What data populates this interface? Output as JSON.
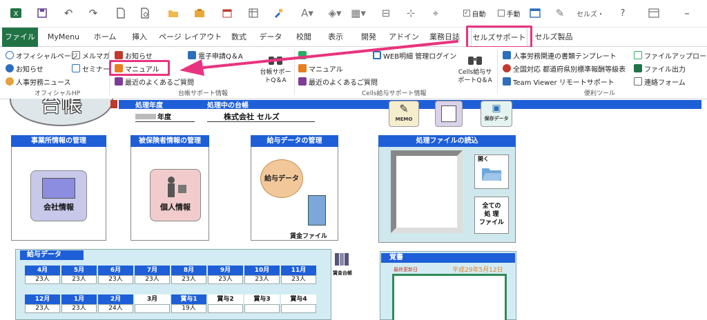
{
  "toolbar": {
    "auto_label": "自動",
    "manual_label": "手動",
    "cells_menu": "セルズ・",
    "help": "?"
  },
  "tabs": [
    "ファイル",
    "MyMenu",
    "ホーム",
    "挿入",
    "ページ レイアウト",
    "数式",
    "データ",
    "校閲",
    "表示",
    "開発",
    "アドイン",
    "業務日誌",
    "セルズサポート",
    "セルズ製品"
  ],
  "ribbon": {
    "official": {
      "items": [
        "オフィシャルページ",
        "メルマガ",
        "お知らせ",
        "セミナー",
        "人事労務ニュース"
      ],
      "group": "オフィシャルHP"
    },
    "daicho": {
      "items": [
        "お知らせ",
        "マニュアル",
        "最近のよくあるご質問",
        "電子申請Q＆A"
      ],
      "big_button": [
        "台帳サポー",
        "トQ＆A"
      ],
      "group": "台帳サポート情報"
    },
    "cells_kyuyo": {
      "items": [
        "マニュアル",
        "最近のよくあるご質問",
        "WEB明細 管理ログイン"
      ],
      "big_button": [
        "Cells給与サ",
        "ポートQ＆A"
      ],
      "group": "Cells給与サポート情報"
    },
    "benri": {
      "items": [
        "人事労務関連の書類テンプレート",
        "全国対応 都道府県別標準報酬等級表",
        "Team Viewer リモートサポート",
        "ファイルアップロード",
        "ファイル出力",
        "連絡フォーム"
      ],
      "group": "便利ツール"
    }
  },
  "sheet": {
    "logo_text": "台帳",
    "header_left": "処理年度",
    "header_right": "処理中の台帳",
    "year_suffix": "年度",
    "company": "株式会社 セルズ",
    "memo": "MEMO",
    "save_data": "保存データ",
    "panels": {
      "office": {
        "title": "事業所情報の管理",
        "button": "会社情報"
      },
      "insured": {
        "title": "被保険者情報の管理",
        "button": "個人情報"
      },
      "salary": {
        "title": "給与データの管理",
        "button": "給与データ",
        "file": "賃金ファイル"
      },
      "files": {
        "title": "処理ファイルの読込",
        "open": "開く",
        "all": [
          "全ての",
          "処 理",
          "ファイル"
        ]
      }
    },
    "kyuyo": {
      "title": "給与データ",
      "row1_months": [
        "4月",
        "5月",
        "6月",
        "7月",
        "8月",
        "9月",
        "10月",
        "11月"
      ],
      "row1_values": [
        "23人",
        "23人",
        "23人",
        "23人",
        "23人",
        "23人",
        "23人",
        "23人"
      ],
      "row2_months": [
        "12月",
        "1月",
        "2月",
        "3月",
        "賞与1",
        "賞与2",
        "賞与3",
        "賞与4"
      ],
      "row2_values": [
        "23人",
        "23人",
        "24人",
        "",
        "19人",
        "",
        "",
        ""
      ],
      "wage_book": "賃金台帳"
    },
    "memo_panel": {
      "title": "覚書",
      "updated_label": "最終更新日",
      "updated_date": "平成29年5月12日"
    }
  },
  "colors": {
    "excel_green": "#217346",
    "accent_pink": "#e8347f",
    "panel_blue": "#1e5fd8"
  }
}
